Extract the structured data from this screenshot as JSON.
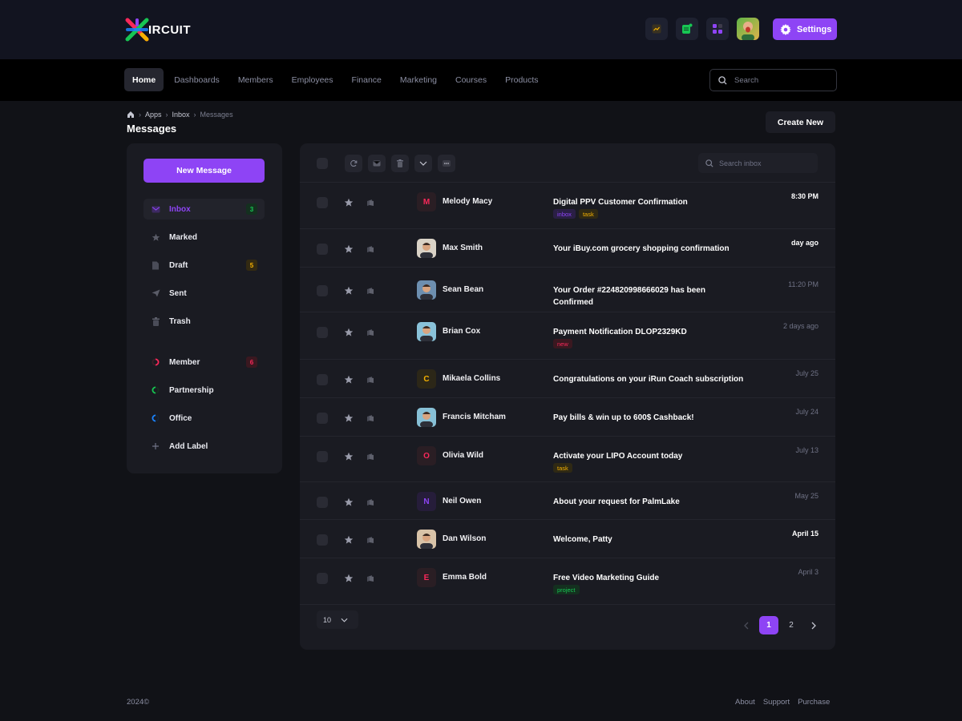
{
  "app": {
    "logo_text": "IRCUIT"
  },
  "header": {
    "settings_label": "Settings",
    "icons": [
      "chart-icon",
      "notes-icon",
      "apps-icon"
    ]
  },
  "nav": {
    "links": [
      "Home",
      "Dashboards",
      "Members",
      "Employees",
      "Finance",
      "Marketing",
      "Courses",
      "Products"
    ],
    "active": "Home",
    "search_placeholder": "Search"
  },
  "breadcrumb": [
    "Apps",
    "Inbox",
    "Messages"
  ],
  "page": {
    "title": "Messages",
    "create_label": "Create  New"
  },
  "sidebar": {
    "new_message_label": "New Message",
    "folders": [
      {
        "label": "Inbox",
        "icon": "envelope-icon",
        "count": "3",
        "count_color": "#17c653"
      },
      {
        "label": "Marked",
        "icon": "star-icon",
        "count": ""
      },
      {
        "label": "Draft",
        "icon": "document-icon",
        "count": "5",
        "count_color": "#f6b100"
      },
      {
        "label": "Sent",
        "icon": "paper-plane-icon",
        "count": ""
      },
      {
        "label": "Trash",
        "icon": "trash-icon",
        "count": ""
      }
    ],
    "labels": [
      {
        "label": "Member",
        "color": "#f8285a",
        "count": "6"
      },
      {
        "label": "Partnership",
        "color": "#17c653",
        "count": ""
      },
      {
        "label": "Office",
        "color": "#1b84ff",
        "count": ""
      }
    ],
    "add_label": "Add Label"
  },
  "inbox": {
    "search_placeholder": "Search inbox",
    "messages": [
      {
        "sender": "Melody Macy",
        "initial": "M",
        "initial_color": "#f8285a",
        "subject": "Digital PPV Customer Confirmation",
        "tags": [
          {
            "text": "inbox",
            "color": "#8e44f5"
          },
          {
            "text": "task",
            "color": "#f6b100"
          }
        ],
        "time": "8:30 PM",
        "time_bold": true
      },
      {
        "sender": "Max Smith",
        "photo": true,
        "subject": "Your iBuy.com grocery shopping confirmation",
        "tags": [],
        "time": "day ago",
        "time_bold": true
      },
      {
        "sender": "Sean Bean",
        "photo": true,
        "subject": "Your Order #224820998666029 has been Confirmed",
        "tags": [],
        "time": "11:20 PM",
        "time_bold": false
      },
      {
        "sender": "Brian Cox",
        "photo": true,
        "subject": "Payment Notification DLOP2329KD",
        "tags": [
          {
            "text": "new",
            "color": "#f8285a"
          }
        ],
        "time": "2 days ago",
        "time_bold": false
      },
      {
        "sender": "Mikaela Collins",
        "initial": "C",
        "initial_color": "#f6b100",
        "subject": "Congratulations on your iRun Coach subscription",
        "tags": [],
        "time": "July 25",
        "time_bold": false
      },
      {
        "sender": "Francis Mitcham",
        "photo": true,
        "subject": "Pay bills & win up to 600$ Cashback!",
        "tags": [],
        "time": "July 24",
        "time_bold": false
      },
      {
        "sender": "Olivia Wild",
        "initial": "O",
        "initial_color": "#f8285a",
        "subject": "Activate your LIPO Account today",
        "tags": [
          {
            "text": "task",
            "color": "#f6b100"
          }
        ],
        "time": "July 13",
        "time_bold": false
      },
      {
        "sender": "Neil Owen",
        "initial": "N",
        "initial_color": "#8e44f5",
        "subject": "About your request for PalmLake",
        "tags": [],
        "time": "May 25",
        "time_bold": false
      },
      {
        "sender": "Dan Wilson",
        "photo": true,
        "subject": "Welcome, Patty",
        "tags": [],
        "time": "April 15",
        "time_bold": true
      },
      {
        "sender": "Emma Bold",
        "initial": "E",
        "initial_color": "#f8285a",
        "subject": "Free Video Marketing Guide",
        "tags": [
          {
            "text": "project",
            "color": "#17c653"
          }
        ],
        "time": "April 3",
        "time_bold": false
      }
    ],
    "per_page": "10",
    "pages": [
      "1",
      "2"
    ],
    "current_page": "1"
  },
  "footer": {
    "copyright": "2024©",
    "links": [
      "About",
      "Support",
      "Purchase"
    ]
  }
}
